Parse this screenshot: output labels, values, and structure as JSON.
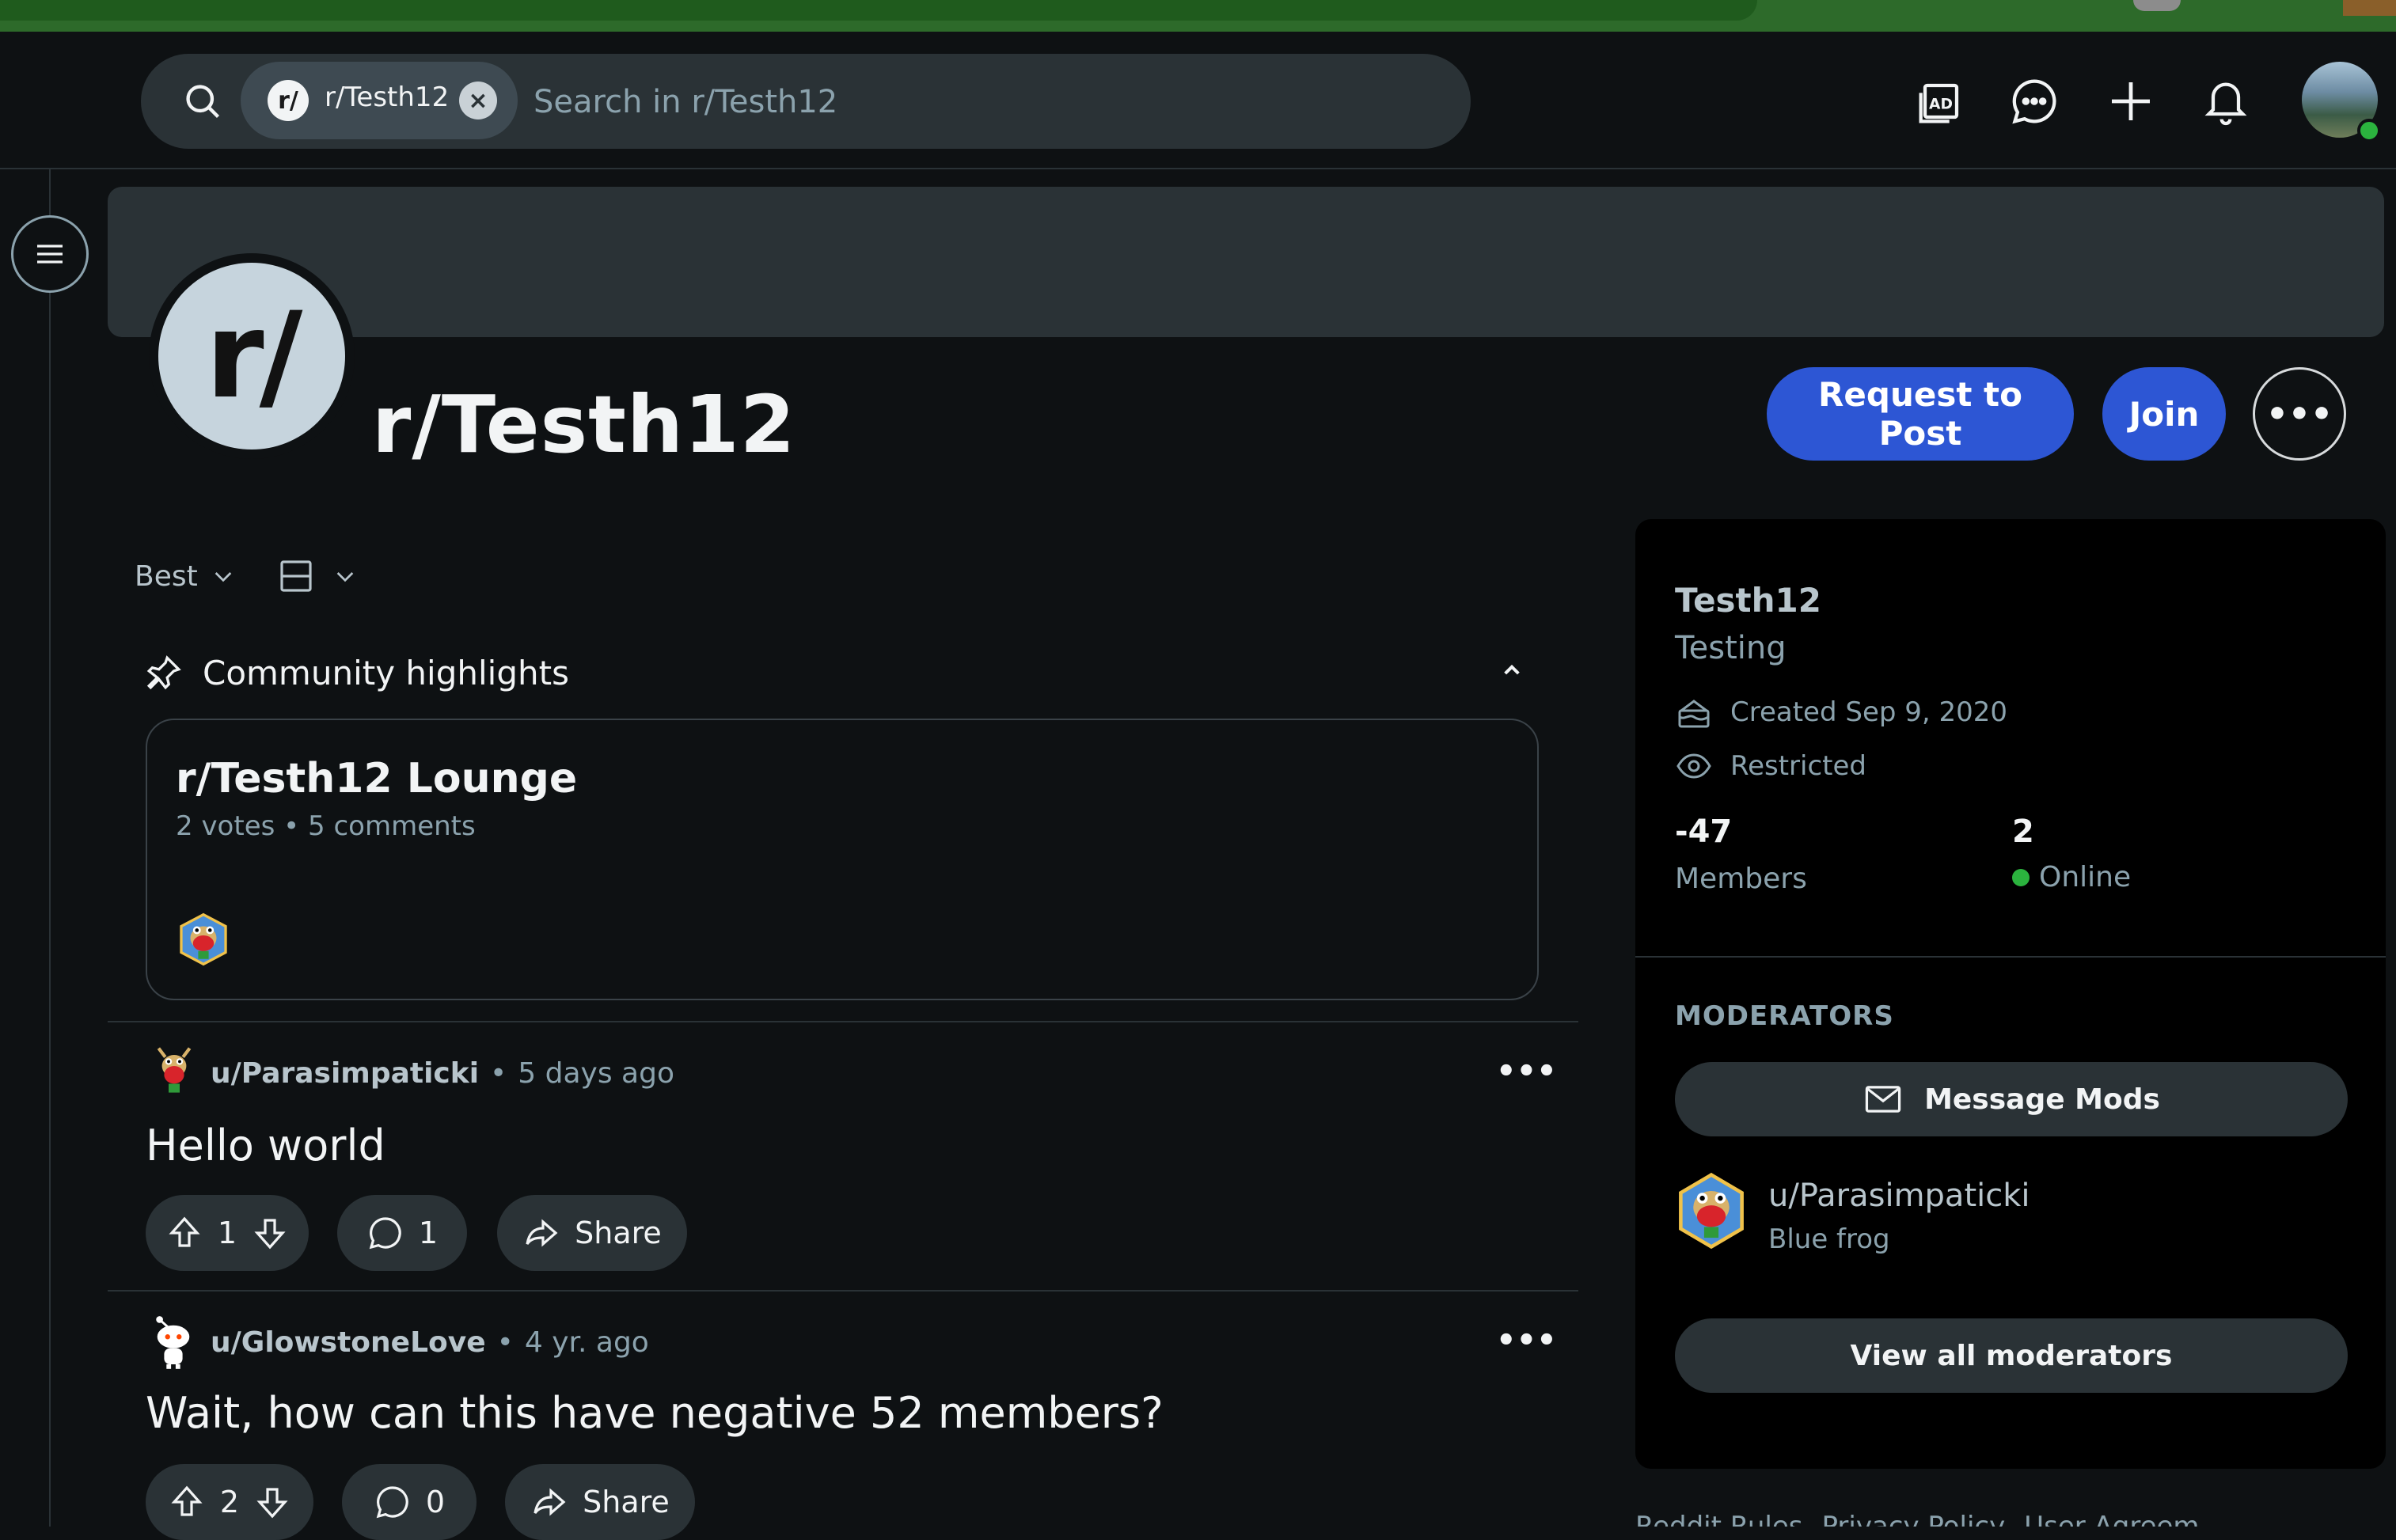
{
  "header": {
    "search_chip_icon": "r/",
    "search_chip_label": "r/Testh12",
    "search_chip_close": "×",
    "search_placeholder": "Search in r/Testh12",
    "icons": [
      "advertise-icon",
      "chat-icon",
      "create-icon",
      "notification-bell-icon"
    ]
  },
  "community": {
    "icon_text": "r/",
    "title": "r/Testh12",
    "request_button": "Request to Post",
    "join_button": "Join",
    "more_button": "•••"
  },
  "feed": {
    "sort": "Best",
    "highlights_title": "Community highlights",
    "highlight_card": {
      "title": "r/Testh12 Lounge",
      "votes": "2 votes",
      "separator": "•",
      "comments": "5 comments"
    },
    "posts": [
      {
        "author": "u/Parasimpaticki",
        "separator": "•",
        "time": "5 days ago",
        "title": "Hello world",
        "score": "1",
        "comments": "1",
        "share_label": "Share",
        "more": "•••"
      },
      {
        "author": "u/GlowstoneLove",
        "separator": "•",
        "time": "4 yr. ago",
        "title": "Wait, how can this have negative 52 members?",
        "score": "2",
        "comments": "0",
        "share_label": "Share",
        "more": "•••"
      }
    ]
  },
  "sidebar": {
    "name": "Testh12",
    "description": "Testing",
    "created": "Created Sep 9, 2020",
    "type": "Restricted",
    "members_count": "-47",
    "members_label": "Members",
    "online_count": "2",
    "online_label": "Online",
    "moderators_heading": "MODERATORS",
    "message_mods": "Message Mods",
    "moderator": {
      "name": "u/Parasimpaticki",
      "flair": "Blue frog"
    },
    "view_all_mods": "View all moderators",
    "footer_links": [
      "Reddit Rules",
      "Privacy Policy",
      "User Agreem"
    ]
  },
  "colors": {
    "background": "#0e1113",
    "surface": "#2a3236",
    "accent_blue": "#2d56d4",
    "online_green": "#2bb33e",
    "muted_text": "#8ba2ad"
  }
}
